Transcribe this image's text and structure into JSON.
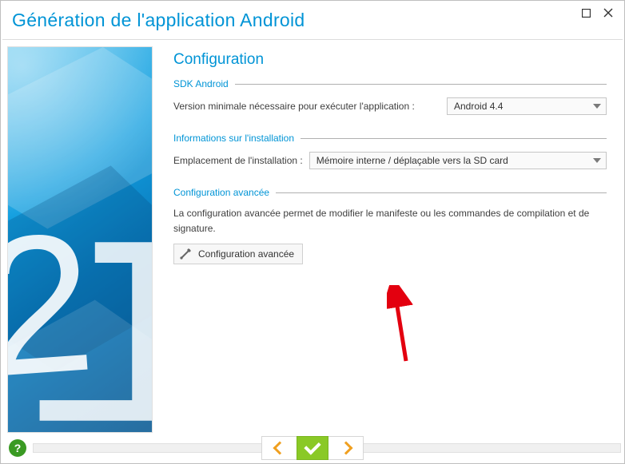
{
  "window": {
    "title": "Génération de l'application Android"
  },
  "sections": {
    "heading": "Configuration",
    "sdk": {
      "legend": "SDK Android",
      "version_label": "Version minimale nécessaire pour exécuter l'application :",
      "version_value": "Android 4.4"
    },
    "install": {
      "legend": "Informations sur l'installation",
      "location_label": "Emplacement de l'installation :",
      "location_value": "Mémoire interne / déplaçable vers la SD card"
    },
    "advanced": {
      "legend": "Configuration avancée",
      "description": "La configuration avancée permet de modifier le manifeste ou les commandes de compilation et de signature.",
      "button_label": "Configuration avancée"
    }
  },
  "footer": {
    "help": "?"
  }
}
